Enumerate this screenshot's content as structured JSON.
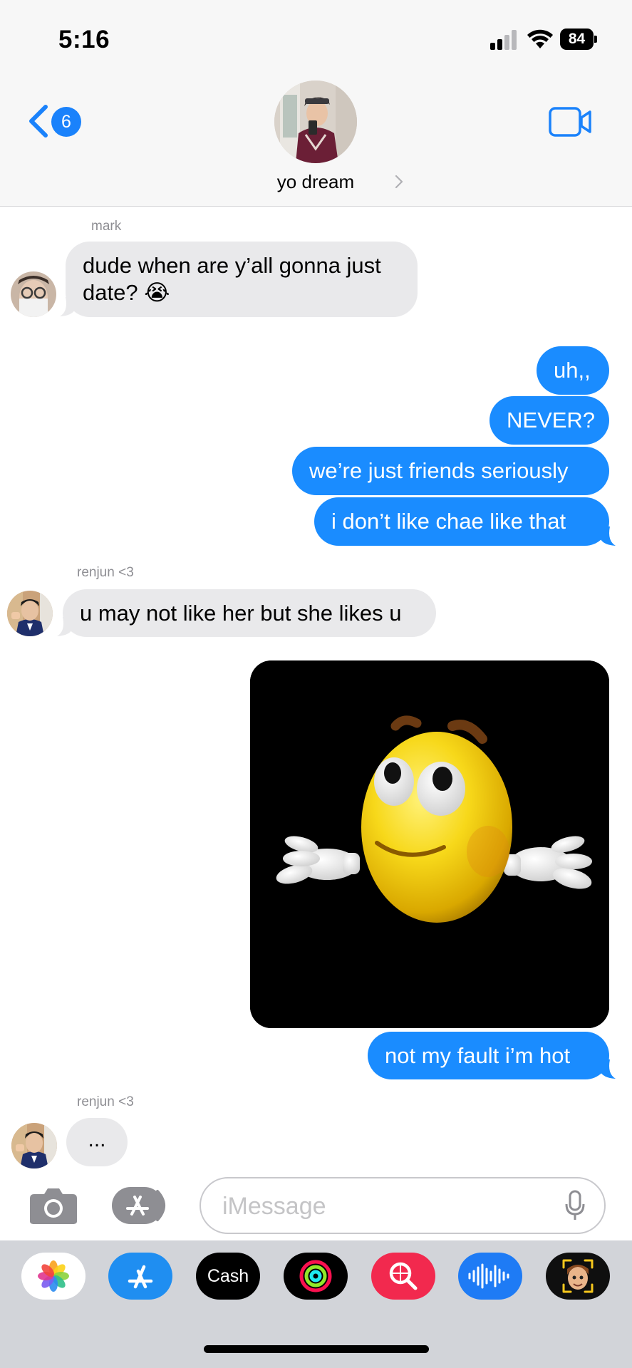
{
  "status_bar": {
    "time": "5:16",
    "battery": "84"
  },
  "header": {
    "back_badge": "6",
    "contact_name": "yo dream",
    "icons": [
      "chevron-left-icon",
      "video-camera-icon",
      "chevron-right-icon"
    ]
  },
  "messages": [
    {
      "sender": "mark",
      "lines": [
        "dude when are y’all gonna just",
        "date? 😭"
      ],
      "direction": "incoming"
    },
    {
      "text": "uh,,",
      "direction": "outgoing"
    },
    {
      "text": "NEVER?",
      "direction": "outgoing"
    },
    {
      "text": "we’re just friends seriously",
      "direction": "outgoing"
    },
    {
      "text": "i don’t like chae like that",
      "direction": "outgoing"
    },
    {
      "sender": "renjun <3",
      "text": "u may not like her but she likes u",
      "direction": "incoming"
    },
    {
      "attachment": "shrugging-emoji-image",
      "direction": "outgoing"
    },
    {
      "text": "not my fault i’m hot",
      "direction": "outgoing"
    },
    {
      "sender": "renjun <3",
      "text": "...",
      "direction": "incoming"
    }
  ],
  "input": {
    "placeholder": "iMessage"
  },
  "app_drawer": {
    "items": [
      "photos-icon",
      "app-store-icon",
      "Cash",
      "fitness-icon",
      "image-search-icon",
      "audio-message-icon",
      "memoji-icon"
    ]
  },
  "colors": {
    "outgoing_bubble": "#1a8cff",
    "incoming_bubble": "#e9e9eb",
    "accent": "#1a82fb"
  }
}
